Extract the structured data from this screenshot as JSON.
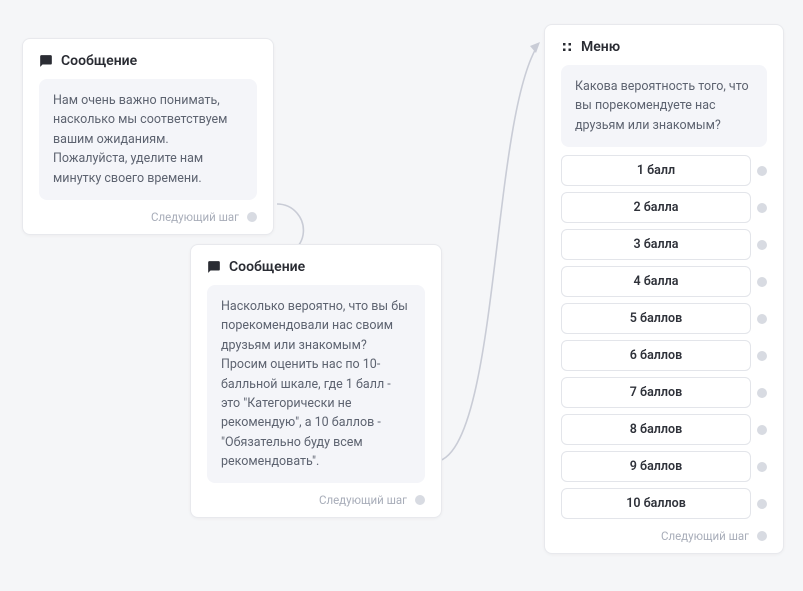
{
  "card1": {
    "title": "Сообщение",
    "body": "Нам очень важно понимать, насколько мы соответствуем вашим ожиданиям. Пожалуйста, уделите нам минутку своего времени.",
    "next": "Следующий шаг"
  },
  "card2": {
    "title": "Сообщение",
    "body": "Насколько вероятно, что вы бы порекомендовали нас своим друзьям или знакомым? Просим оценить нас по 10-балльной шкале, где 1 балл - это \"Категорически не рекомендую\", а 10 баллов - \"Обязательно буду всем рекомендовать\".",
    "next": "Следующий шаг"
  },
  "card3": {
    "title": "Меню",
    "question": "Какова вероятность того, что вы порекомендуете нас друзьям или знакомым?",
    "options": [
      "1 балл",
      "2 балла",
      "3 балла",
      "4 балла",
      "5 баллов",
      "6 баллов",
      "7 баллов",
      "8 баллов",
      "9 баллов",
      "10 баллов"
    ],
    "next": "Следующий шаг"
  }
}
